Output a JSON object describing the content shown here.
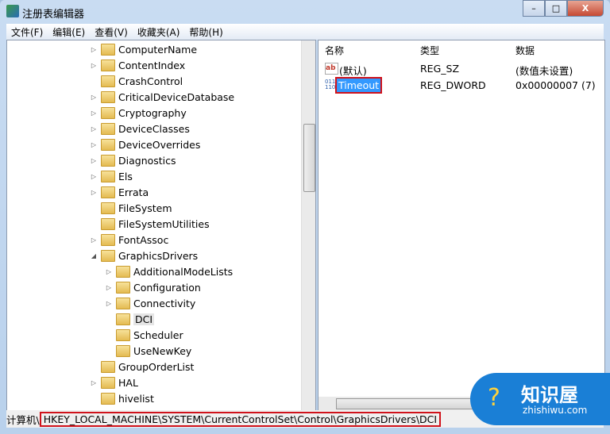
{
  "window": {
    "title": "注册表编辑器",
    "controls": {
      "minimize": "–",
      "maximize": "□",
      "close": "X"
    }
  },
  "menu": [
    "文件(F)",
    "编辑(E)",
    "查看(V)",
    "收藏夹(A)",
    "帮助(H)"
  ],
  "tree": [
    {
      "label": "ComputerName",
      "level": 1,
      "expander": "▷"
    },
    {
      "label": "ContentIndex",
      "level": 1,
      "expander": "▷"
    },
    {
      "label": "CrashControl",
      "level": 1,
      "expander": ""
    },
    {
      "label": "CriticalDeviceDatabase",
      "level": 1,
      "expander": "▷"
    },
    {
      "label": "Cryptography",
      "level": 1,
      "expander": "▷"
    },
    {
      "label": "DeviceClasses",
      "level": 1,
      "expander": "▷"
    },
    {
      "label": "DeviceOverrides",
      "level": 1,
      "expander": "▷"
    },
    {
      "label": "Diagnostics",
      "level": 1,
      "expander": "▷"
    },
    {
      "label": "Els",
      "level": 1,
      "expander": "▷"
    },
    {
      "label": "Errata",
      "level": 1,
      "expander": "▷"
    },
    {
      "label": "FileSystem",
      "level": 1,
      "expander": ""
    },
    {
      "label": "FileSystemUtilities",
      "level": 1,
      "expander": ""
    },
    {
      "label": "FontAssoc",
      "level": 1,
      "expander": "▷"
    },
    {
      "label": "GraphicsDrivers",
      "level": 1,
      "expander": "◢"
    },
    {
      "label": "AdditionalModeLists",
      "level": 2,
      "expander": "▷"
    },
    {
      "label": "Configuration",
      "level": 2,
      "expander": "▷"
    },
    {
      "label": "Connectivity",
      "level": 2,
      "expander": "▷"
    },
    {
      "label": "DCI",
      "level": 2,
      "expander": "",
      "selected": true
    },
    {
      "label": "Scheduler",
      "level": 2,
      "expander": ""
    },
    {
      "label": "UseNewKey",
      "level": 2,
      "expander": ""
    },
    {
      "label": "GroupOrderList",
      "level": 1,
      "expander": ""
    },
    {
      "label": "HAL",
      "level": 1,
      "expander": "▷"
    },
    {
      "label": "hivelist",
      "level": 1,
      "expander": ""
    }
  ],
  "list": {
    "headers": [
      "名称",
      "类型",
      "数据"
    ],
    "rows": [
      {
        "icon": "string-value-icon",
        "name": "(默认)",
        "type": "REG_SZ",
        "data": "(数值未设置)"
      },
      {
        "icon": "binary-value-icon",
        "name": "Timeout",
        "type": "REG_DWORD",
        "data": "0x00000007 (7)",
        "selected": true
      }
    ]
  },
  "status": {
    "prefix": "计算机\\",
    "path": "HKEY_LOCAL_MACHINE\\SYSTEM\\CurrentControlSet\\Control\\GraphicsDrivers\\DCI"
  },
  "watermark": {
    "brand": "知识屋",
    "url": "zhishiwu.com"
  }
}
